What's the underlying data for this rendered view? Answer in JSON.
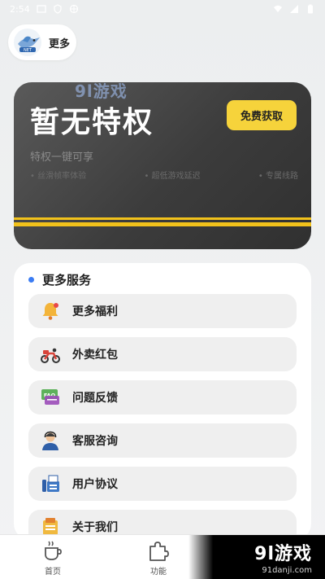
{
  "status_bar": {
    "time": "2:54"
  },
  "header": {
    "title": "更多"
  },
  "privilege": {
    "title": "暂无特权",
    "button": "免费获取",
    "subtitle": "特权一键可享",
    "features": [
      "丝滑帧率体验",
      "超低游戏延迟",
      "专属线路"
    ],
    "watermark": "9l游戏",
    "accent_color": "#f6d33b"
  },
  "services": {
    "title": "更多服务",
    "items": [
      {
        "label": "更多福利",
        "icon": "bell-icon"
      },
      {
        "label": "外卖红包",
        "icon": "scooter-icon"
      },
      {
        "label": "问题反馈",
        "icon": "faq-icon"
      },
      {
        "label": "客服咨询",
        "icon": "support-agent-icon"
      },
      {
        "label": "用户协议",
        "icon": "fax-icon"
      },
      {
        "label": "关于我们",
        "icon": "about-icon"
      }
    ]
  },
  "nav": {
    "tabs": [
      {
        "label": "首页",
        "icon": "coffee-cup-icon"
      },
      {
        "label": "功能",
        "icon": "puzzle-icon"
      }
    ]
  },
  "brand": {
    "name": "9l游戏",
    "url": "91danji.com"
  }
}
